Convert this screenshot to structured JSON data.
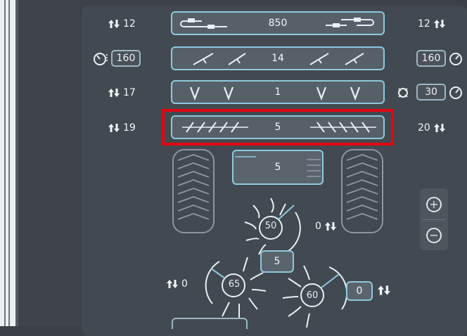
{
  "rows": [
    {
      "left_value": "12",
      "center_value": "850",
      "right_value": "12"
    },
    {
      "left_box": "160",
      "center_value": "14",
      "right_box": "160"
    },
    {
      "left_value": "17",
      "center_value": "1",
      "right_box": "30"
    },
    {
      "left_value": "19",
      "center_value": "5",
      "right_value": "20"
    }
  ],
  "drum_box": "5",
  "rotors": [
    {
      "label": "50"
    },
    {
      "label": "65"
    },
    {
      "label": "60"
    }
  ],
  "rotor_right_value": "0",
  "center_small_box": "5",
  "bottom_left_value": "0",
  "bottom_right_box": "0",
  "zoom": {
    "plus": "+",
    "minus": "−"
  },
  "colors": {
    "accent": "#8fc9de",
    "highlight": "#e30613",
    "bg": "#3b4147"
  }
}
